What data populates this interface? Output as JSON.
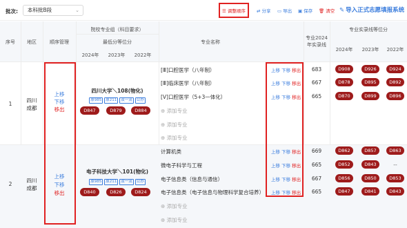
{
  "toolbar": {
    "batch_label": "批次:",
    "batch_value": "本科批B段",
    "adjust_order": "调整顺序",
    "share": "分享",
    "export": "导出",
    "save": "保存",
    "clear": "清空",
    "import": "导入正式志愿填报系统"
  },
  "header": {
    "seq": "序号",
    "region": "地区",
    "order_mgmt": "顺序管理",
    "group": "院校专业组（科目要求）",
    "min_rank": "最低分等位分",
    "y2024": "2024年",
    "y2023": "2023年",
    "y2022": "2022年",
    "major_name": "专业名称",
    "major_2024_line": "专业2024年实录线",
    "major_rank": "专业实录线等位分",
    "my2024": "2024年",
    "my2023": "2023年",
    "my2022": "2022年"
  },
  "actions": {
    "up": "上移",
    "down": "下移",
    "remove": "移出",
    "add_major": "添加专业"
  },
  "rows": [
    {
      "seq": "1",
      "region": "四川\n成都",
      "school": "四川大学＼108(物化)",
      "tags": [
        "原985",
        "原211",
        "双一流",
        "公办"
      ],
      "ranks": [
        "D847",
        "D879",
        "D884"
      ],
      "majors": [
        {
          "name": "[Ⅲ]口腔医学（八年制）",
          "line": "683",
          "ranks": [
            "D908",
            "D926",
            "D924"
          ]
        },
        {
          "name": "[Ⅲ]临床医学（八年制）",
          "line": "667",
          "ranks": [
            "D878",
            "D895",
            "D892"
          ]
        },
        {
          "name": "[Ⅴ]口腔医学（5+3一体化）",
          "line": "665",
          "ranks": [
            "D870",
            "D899",
            "D896"
          ]
        }
      ]
    },
    {
      "seq": "2",
      "region": "四川\n成都",
      "school": "电子科技大学＼101(物化)",
      "tags": [
        "原985",
        "原211",
        "双一流",
        "公办"
      ],
      "ranks": [
        "D840",
        "D826",
        "D824"
      ],
      "majors": [
        {
          "name": "计算机类",
          "line": "669",
          "ranks": [
            "D862",
            "D857",
            "D863"
          ]
        },
        {
          "name": "微电子科学与工程",
          "line": "665",
          "ranks": [
            "D852",
            "D843",
            "--"
          ]
        },
        {
          "name": "电子信息类（信息与通信）",
          "line": "667",
          "ranks": [
            "D856",
            "D850",
            "D853"
          ]
        },
        {
          "name": "电子信息类（电子信息与物理科学复合培养）",
          "line": "665",
          "ranks": [
            "D847",
            "D841",
            "D843"
          ]
        }
      ]
    }
  ]
}
